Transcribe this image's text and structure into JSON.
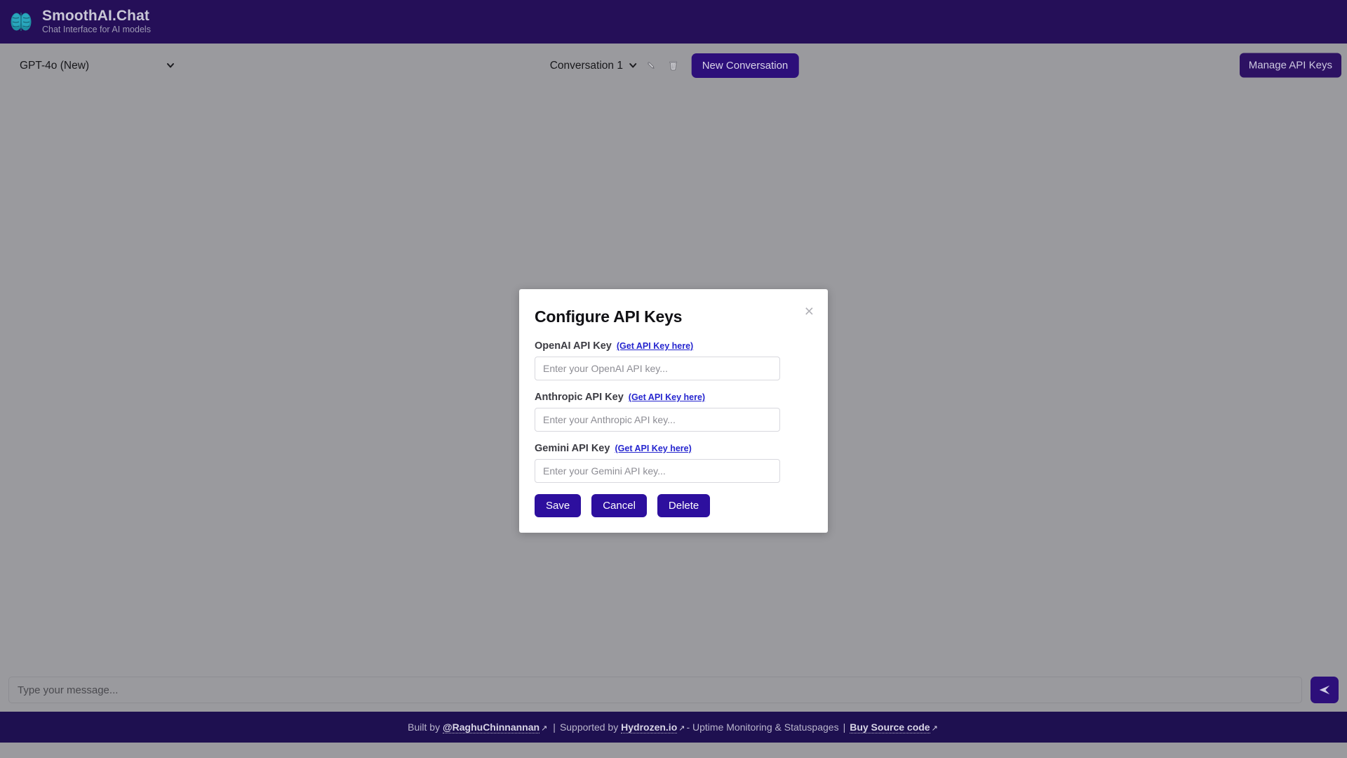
{
  "brand": {
    "title": "SmoothAI.Chat",
    "subtitle": "Chat Interface for AI models",
    "logo_icon": "brain-icon",
    "accent_dark": "#250f58",
    "accent_indigo": "#2d0f7a",
    "page_bg": "#9a9a9e"
  },
  "toolbar": {
    "model_selected": "GPT-4o (New)",
    "model_caret_icon": "chevron-down-icon",
    "conversation_selected": "Conversation 1",
    "conversation_caret_icon": "chevron-down-icon",
    "edit_icon": "pencil-icon",
    "delete_icon": "trash-icon",
    "new_conversation_label": "New Conversation",
    "manage_api_keys_label": "Manage API Keys"
  },
  "composer": {
    "placeholder": "Type your message...",
    "value": "",
    "send_icon": "send-paper-plane-icon"
  },
  "modal": {
    "title": "Configure API Keys",
    "close_icon": "close-icon",
    "close_label": "×",
    "link_label": "(Get API Key here)",
    "link_color": "#2525cf",
    "fields": [
      {
        "label": "OpenAI API Key",
        "link": "(Get API Key here)",
        "placeholder": "Enter your OpenAI API key...",
        "value": ""
      },
      {
        "label": "Anthropic API Key",
        "link": "(Get API Key here)",
        "placeholder": "Enter your Anthropic API key...",
        "value": ""
      },
      {
        "label": "Gemini API Key",
        "link": "(Get API Key here)",
        "placeholder": "Enter your Gemini API key...",
        "value": ""
      }
    ],
    "buttons": {
      "save": "Save",
      "cancel": "Cancel",
      "delete": "Delete"
    }
  },
  "footer": {
    "built_by_prefix": "Built by",
    "author_link": "@RaghuChinnannan",
    "separator1": "|",
    "supported_by_prefix": "Supported by",
    "sponsor_link": "Hydrozen.io",
    "sponsor_tagline": "- Uptime Monitoring & Statuspages",
    "separator2": "|",
    "source_link": "Buy Source code",
    "external_icon": "↗"
  }
}
